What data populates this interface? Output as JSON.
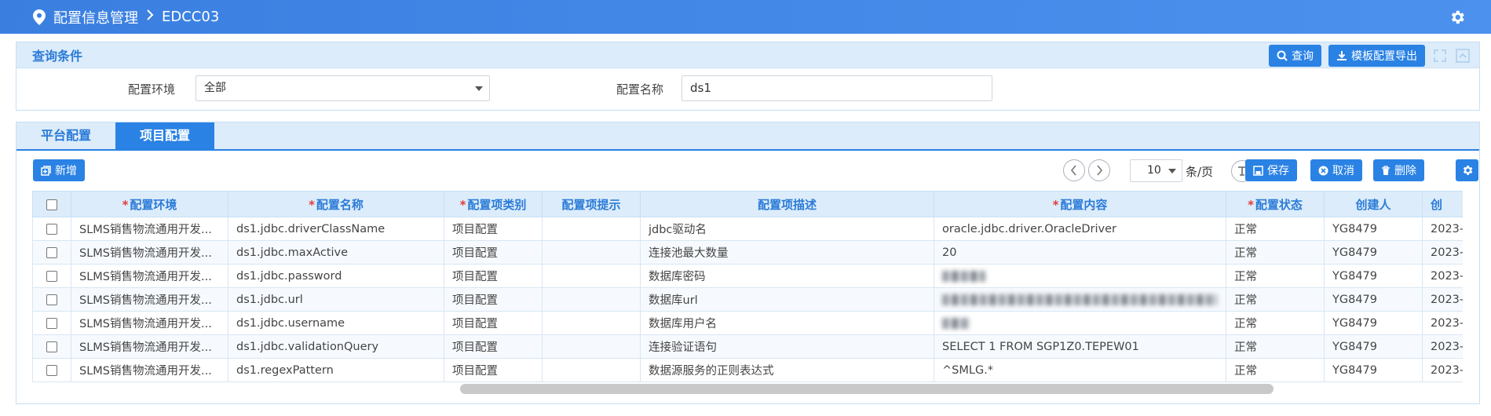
{
  "header": {
    "breadcrumb": [
      "配置信息管理",
      "EDCC03"
    ],
    "location_icon": "location-pin-icon",
    "settings_icon": "gear-icon"
  },
  "query": {
    "title": "查询条件",
    "search_label": "查询",
    "export_label": "模板配置导出",
    "env_label": "配置环境",
    "env_value": "全部",
    "name_label": "配置名称",
    "name_value": "ds1"
  },
  "tabs": [
    {
      "label": "平台配置",
      "active": false
    },
    {
      "label": "项目配置",
      "active": true
    }
  ],
  "toolbar": {
    "add_label": "新增",
    "page_size": "10",
    "per_page_label": "条/页",
    "save_label": "保存",
    "cancel_label": "取消",
    "delete_label": "删除"
  },
  "table": {
    "columns": [
      {
        "label": "配置环境",
        "required": true
      },
      {
        "label": "配置名称",
        "required": true
      },
      {
        "label": "配置项类别",
        "required": true
      },
      {
        "label": "配置项提示",
        "required": false
      },
      {
        "label": "配置项描述",
        "required": false
      },
      {
        "label": "配置内容",
        "required": true
      },
      {
        "label": "配置状态",
        "required": true
      },
      {
        "label": "创建人",
        "required": false
      },
      {
        "label": "创",
        "required": false
      }
    ],
    "rows": [
      {
        "env": "SLMS销售物流通用开发...",
        "name": "ds1.jdbc.driverClassName",
        "category": "项目配置",
        "hint": "",
        "desc": "jdbc驱动名",
        "content": "oracle.jdbc.driver.OracleDriver",
        "status": "正常",
        "creator": "YG8479",
        "created": "2023-"
      },
      {
        "env": "SLMS销售物流通用开发...",
        "name": "ds1.jdbc.maxActive",
        "category": "项目配置",
        "hint": "",
        "desc": "连接池最大数量",
        "content": "20",
        "status": "正常",
        "creator": "YG8479",
        "created": "2023-"
      },
      {
        "env": "SLMS销售物流通用开发...",
        "name": "ds1.jdbc.password",
        "category": "项目配置",
        "hint": "",
        "desc": "数据库密码",
        "content": "",
        "status": "正常",
        "creator": "YG8479",
        "created": "2023-"
      },
      {
        "env": "SLMS销售物流通用开发...",
        "name": "ds1.jdbc.url",
        "category": "项目配置",
        "hint": "",
        "desc": "数据库url",
        "content": "",
        "status": "正常",
        "creator": "YG8479",
        "created": "2023-"
      },
      {
        "env": "SLMS销售物流通用开发...",
        "name": "ds1.jdbc.username",
        "category": "项目配置",
        "hint": "",
        "desc": "数据库用户名",
        "content": "",
        "status": "正常",
        "creator": "YG8479",
        "created": "2023-"
      },
      {
        "env": "SLMS销售物流通用开发...",
        "name": "ds1.jdbc.validationQuery",
        "category": "项目配置",
        "hint": "",
        "desc": "连接验证语句",
        "content": "SELECT 1 FROM SGP1Z0.TEPEW01",
        "status": "正常",
        "creator": "YG8479",
        "created": "2023-"
      },
      {
        "env": "SLMS销售物流通用开发...",
        "name": "ds1.regexPattern",
        "category": "项目配置",
        "hint": "",
        "desc": "数据源服务的正则表达式",
        "content": "^SMLG.*",
        "status": "正常",
        "creator": "YG8479",
        "created": "2023-"
      }
    ]
  },
  "colors": {
    "accent": "#2a82e4",
    "header_bg": "#dcecfa",
    "required": "#e23b3b"
  }
}
